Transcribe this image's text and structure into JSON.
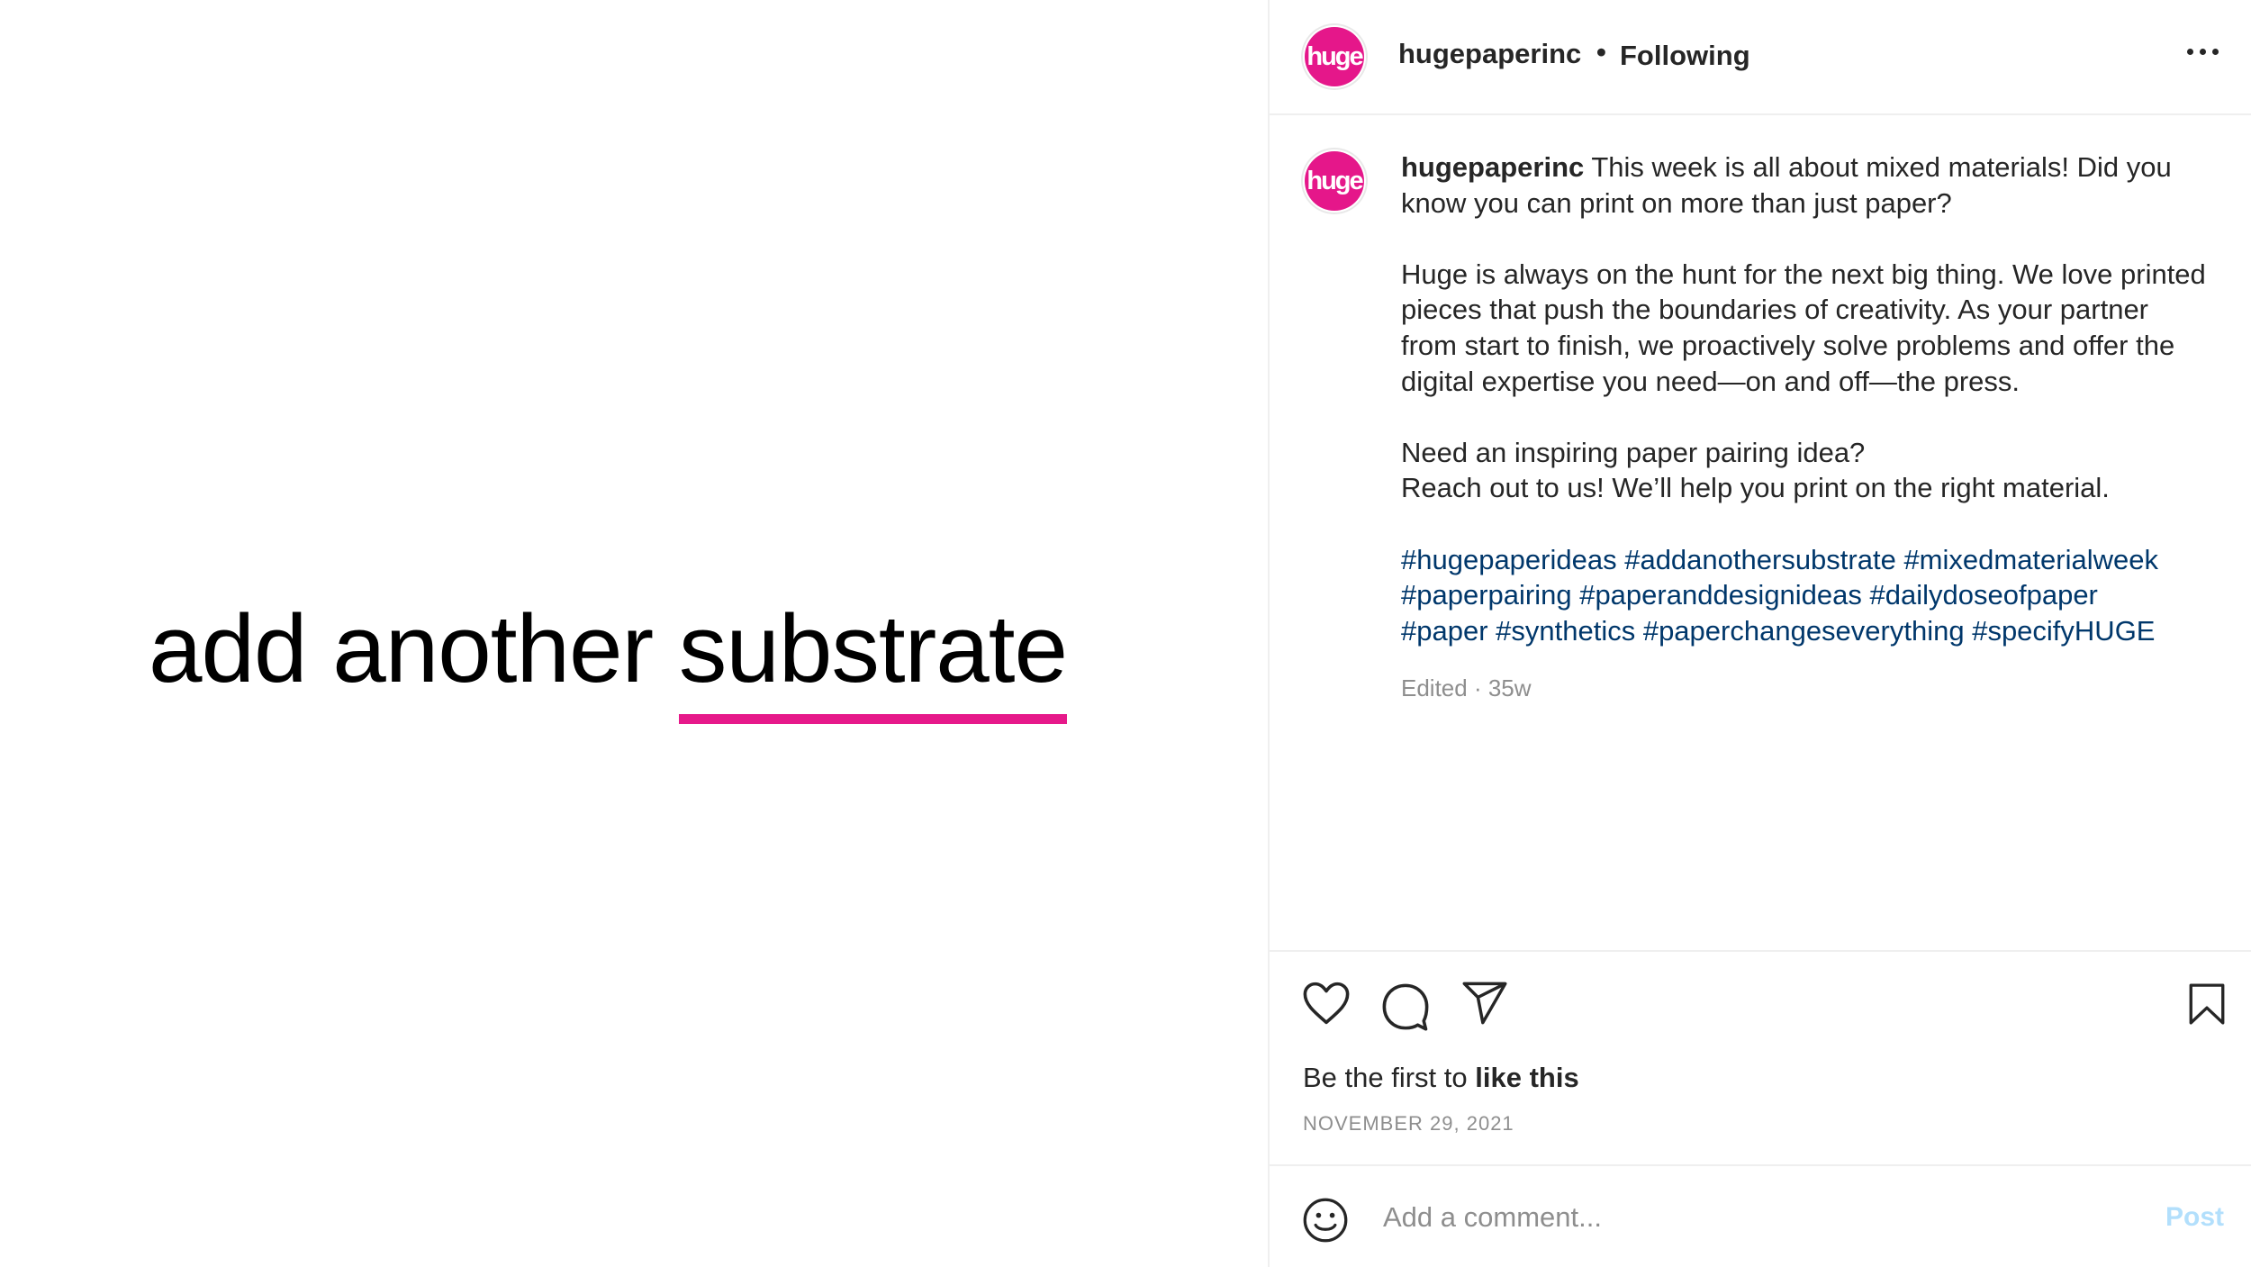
{
  "media": {
    "headline_prefix": "add another ",
    "headline_accent": "substrate",
    "accent_color": "#e6198a"
  },
  "post": {
    "avatar_text": "huge",
    "avatar_color": "#e5178a",
    "username": "hugepaperinc",
    "follow_separator": "•",
    "follow_status": "Following",
    "more_icon": "more-options-icon"
  },
  "caption": {
    "username": "hugepaperinc",
    "intro": "This week is all about mixed materials! Did you know you can print on more than just paper?",
    "paragraph2": "Huge is always on the hunt for the next big thing. We love printed pieces that push the boundaries of creativity. As your partner from start to finish, we proactively solve problems and offer the digital expertise you need—on and off—the press.",
    "paragraph3_line1": "Need an inspiring paper pairing idea?",
    "paragraph3_line2": "Reach out to us! We’ll help you print on the right material.",
    "hashtags_line1": "#hugepaperideas #addanothersubstrate #mixedmaterialweek",
    "hashtags_line2": "#paperpairing #paperanddesignideas #dailydoseofpaper",
    "hashtags_line3": "#paper #synthetics #paperchangeseverything #specifyHUGE",
    "edited": "Edited · 35w"
  },
  "actions": {
    "icons": [
      "heart-icon",
      "comment-icon",
      "share-icon",
      "bookmark-icon"
    ],
    "likes_prefix": "Be the first to ",
    "likes_bold": "like this",
    "date": "NOVEMBER 29, 2021"
  },
  "comment": {
    "placeholder": "Add a comment...",
    "post_label": "Post"
  }
}
